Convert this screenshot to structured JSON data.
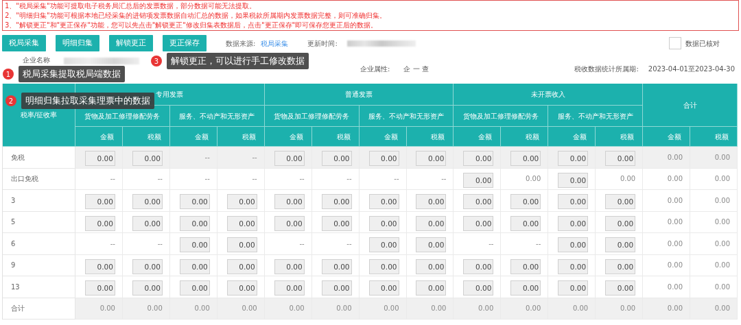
{
  "notices": [
    "1、\"税局采集\"功能可提取电子税务局汇总后的发票数据，部分数据可能无法提取。",
    "2、\"明细归集\"功能可根据本地已经采集的进销项发票数据自动汇总的数据，如果税款所属期内发票数据完整，则可准确归集。",
    "3、\"解锁更正\"和\"更正保存\"功能，您可以先点击\"解锁更正\"修改归集表数据后，点击\"更正保存\"即可保存您更正后的数据。"
  ],
  "toolbar": {
    "buttons": [
      "税局采集",
      "明细归集",
      "解锁更正",
      "更正保存"
    ],
    "source_label": "数据来源:",
    "source_value": "税局采集",
    "updated_label": "更新时间:",
    "verified": {
      "label": "数据已核对",
      "checked": false
    }
  },
  "info": {
    "company_label": "企业名称",
    "attribute_label": "企业属性:",
    "attribute_value": "企 一 查",
    "period_label": "税收数据统计所属期:",
    "period_value": "2023-04-01至2023-04-30"
  },
  "table": {
    "rate_header": "税率/征收率",
    "groups": [
      {
        "title": "专用发票",
        "subs": [
          "货物及加工修理修配劳务",
          "服务、不动产和无形资产"
        ]
      },
      {
        "title": "普通发票",
        "subs": [
          "货物及加工修理修配劳务",
          "服务、不动产和无形资产"
        ]
      },
      {
        "title": "未开票收入",
        "subs": [
          "货物及加工修理修配劳务",
          "服务、不动产和无形资产"
        ]
      }
    ],
    "total_header": "合计",
    "columns": [
      "金额",
      "税额",
      "金额",
      "税额",
      "金额",
      "税额",
      "金额",
      "税额",
      "金额",
      "税额",
      "金额",
      "税额",
      "金额",
      "税额"
    ],
    "rows": [
      {
        "label": "免税",
        "shaded": true,
        "cells": [
          {
            "kind": "input",
            "value": "0.00"
          },
          {
            "kind": "input",
            "value": "0.00"
          },
          {
            "kind": "text",
            "value": "--"
          },
          {
            "kind": "text",
            "value": "--"
          },
          {
            "kind": "input",
            "value": "0.00"
          },
          {
            "kind": "input",
            "value": "0.00"
          },
          {
            "kind": "input",
            "value": "0.00"
          },
          {
            "kind": "input",
            "value": "0.00"
          },
          {
            "kind": "input",
            "value": "0.00"
          },
          {
            "kind": "input",
            "value": "0.00"
          },
          {
            "kind": "input",
            "value": "0.00"
          },
          {
            "kind": "input",
            "value": "0.00"
          },
          {
            "kind": "text",
            "value": "0.00"
          },
          {
            "kind": "text",
            "value": "0.00"
          }
        ]
      },
      {
        "label": "出口免税",
        "shaded": false,
        "cells": [
          {
            "kind": "text",
            "value": "--"
          },
          {
            "kind": "text",
            "value": "--"
          },
          {
            "kind": "text",
            "value": "--"
          },
          {
            "kind": "text",
            "value": "--"
          },
          {
            "kind": "text",
            "value": "--"
          },
          {
            "kind": "text",
            "value": "--"
          },
          {
            "kind": "text",
            "value": "--"
          },
          {
            "kind": "text",
            "value": "--"
          },
          {
            "kind": "input",
            "value": "0.00"
          },
          {
            "kind": "text",
            "value": "0.00"
          },
          {
            "kind": "input",
            "value": "0.00"
          },
          {
            "kind": "text",
            "value": "0.00"
          },
          {
            "kind": "text",
            "value": "0.00"
          },
          {
            "kind": "text",
            "value": "0.00"
          }
        ]
      },
      {
        "label": "3",
        "shaded": false,
        "cells": [
          {
            "kind": "input",
            "value": "0.00"
          },
          {
            "kind": "input",
            "value": "0.00"
          },
          {
            "kind": "input",
            "value": "0.00"
          },
          {
            "kind": "input",
            "value": "0.00"
          },
          {
            "kind": "input",
            "value": "0.00"
          },
          {
            "kind": "input",
            "value": "0.00"
          },
          {
            "kind": "input",
            "value": "0.00"
          },
          {
            "kind": "input",
            "value": "0.00"
          },
          {
            "kind": "input",
            "value": "0.00"
          },
          {
            "kind": "input",
            "value": "0.00"
          },
          {
            "kind": "input",
            "value": "0.00"
          },
          {
            "kind": "input",
            "value": "0.00"
          },
          {
            "kind": "text",
            "value": "0.00"
          },
          {
            "kind": "text",
            "value": "0.00"
          }
        ]
      },
      {
        "label": "5",
        "shaded": false,
        "cells": [
          {
            "kind": "input",
            "value": "0.00"
          },
          {
            "kind": "input",
            "value": "0.00"
          },
          {
            "kind": "input",
            "value": "0.00"
          },
          {
            "kind": "input",
            "value": "0.00"
          },
          {
            "kind": "input",
            "value": "0.00"
          },
          {
            "kind": "input",
            "value": "0.00"
          },
          {
            "kind": "input",
            "value": "0.00"
          },
          {
            "kind": "input",
            "value": "0.00"
          },
          {
            "kind": "input",
            "value": "0.00"
          },
          {
            "kind": "input",
            "value": "0.00"
          },
          {
            "kind": "input",
            "value": "0.00"
          },
          {
            "kind": "input",
            "value": "0.00"
          },
          {
            "kind": "text",
            "value": "0.00"
          },
          {
            "kind": "text",
            "value": "0.00"
          }
        ]
      },
      {
        "label": "6",
        "shaded": false,
        "cells": [
          {
            "kind": "text",
            "value": "--"
          },
          {
            "kind": "text",
            "value": "--"
          },
          {
            "kind": "input",
            "value": "0.00"
          },
          {
            "kind": "input",
            "value": "0.00"
          },
          {
            "kind": "text",
            "value": "--"
          },
          {
            "kind": "text",
            "value": "--"
          },
          {
            "kind": "input",
            "value": "0.00"
          },
          {
            "kind": "input",
            "value": "0.00"
          },
          {
            "kind": "text",
            "value": "--"
          },
          {
            "kind": "text",
            "value": "--"
          },
          {
            "kind": "input",
            "value": "0.00"
          },
          {
            "kind": "input",
            "value": "0.00"
          },
          {
            "kind": "text",
            "value": "0.00"
          },
          {
            "kind": "text",
            "value": "0.00"
          }
        ]
      },
      {
        "label": "9",
        "shaded": false,
        "cells": [
          {
            "kind": "input",
            "value": "0.00"
          },
          {
            "kind": "input",
            "value": "0.00"
          },
          {
            "kind": "input",
            "value": "0.00"
          },
          {
            "kind": "input",
            "value": "0.00"
          },
          {
            "kind": "input",
            "value": "0.00"
          },
          {
            "kind": "input",
            "value": "0.00"
          },
          {
            "kind": "input",
            "value": "0.00"
          },
          {
            "kind": "input",
            "value": "0.00"
          },
          {
            "kind": "input",
            "value": "0.00"
          },
          {
            "kind": "input",
            "value": "0.00"
          },
          {
            "kind": "input",
            "value": "0.00"
          },
          {
            "kind": "input",
            "value": "0.00"
          },
          {
            "kind": "text",
            "value": "0.00"
          },
          {
            "kind": "text",
            "value": "0.00"
          }
        ]
      },
      {
        "label": "13",
        "shaded": false,
        "cells": [
          {
            "kind": "input",
            "value": "0.00"
          },
          {
            "kind": "input",
            "value": "0.00"
          },
          {
            "kind": "input",
            "value": "0.00"
          },
          {
            "kind": "input",
            "value": "0.00"
          },
          {
            "kind": "input",
            "value": "0.00"
          },
          {
            "kind": "input",
            "value": "0.00"
          },
          {
            "kind": "input",
            "value": "0.00"
          },
          {
            "kind": "input",
            "value": "0.00"
          },
          {
            "kind": "input",
            "value": "0.00"
          },
          {
            "kind": "input",
            "value": "0.00"
          },
          {
            "kind": "input",
            "value": "0.00"
          },
          {
            "kind": "input",
            "value": "0.00"
          },
          {
            "kind": "text",
            "value": "0.00"
          },
          {
            "kind": "text",
            "value": "0.00"
          }
        ]
      },
      {
        "label": "合计",
        "shaded": true,
        "cells": [
          {
            "kind": "text",
            "value": "0.00"
          },
          {
            "kind": "text",
            "value": "0.00"
          },
          {
            "kind": "text",
            "value": "0.00"
          },
          {
            "kind": "text",
            "value": "0.00"
          },
          {
            "kind": "text",
            "value": "0.00"
          },
          {
            "kind": "text",
            "value": "0.00"
          },
          {
            "kind": "text",
            "value": "0.00"
          },
          {
            "kind": "text",
            "value": "0.00"
          },
          {
            "kind": "text",
            "value": "0.00"
          },
          {
            "kind": "text",
            "value": "0.00"
          },
          {
            "kind": "text",
            "value": "0.00"
          },
          {
            "kind": "text",
            "value": "0.00"
          },
          {
            "kind": "text",
            "value": "0.00"
          },
          {
            "kind": "text",
            "value": "0.00"
          }
        ]
      }
    ]
  },
  "callouts": [
    {
      "number": "1",
      "text": "税局采集提取税局端数据"
    },
    {
      "number": "2",
      "text": "明细归集拉取采集理票中的数据"
    },
    {
      "number": "3",
      "text": "解锁更正，可以进行手工修改数据"
    }
  ]
}
